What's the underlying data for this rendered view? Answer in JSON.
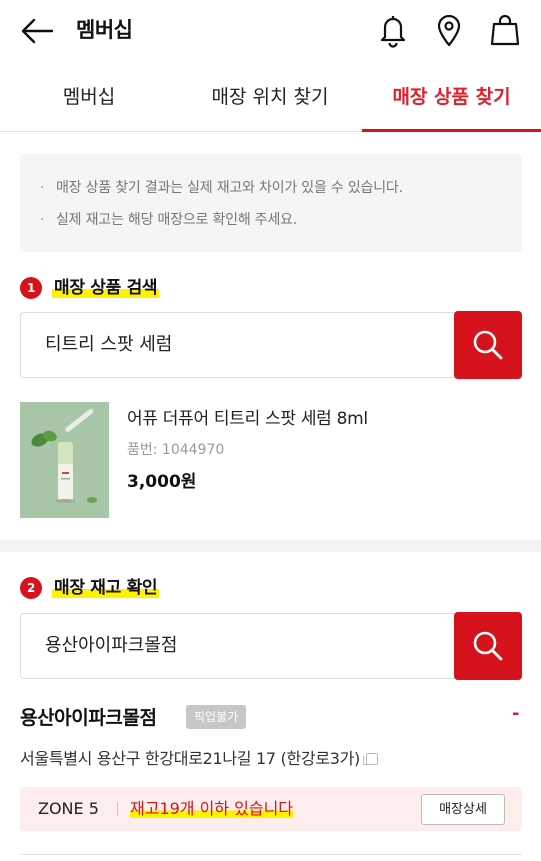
{
  "header": {
    "title": "멤버십"
  },
  "tabs": [
    {
      "label": "멤버십",
      "active": false
    },
    {
      "label": "매장 위치 찾기",
      "active": false
    },
    {
      "label": "매장 상품 찾기",
      "active": true
    }
  ],
  "notice": {
    "lines": [
      "매장 상품 찾기 결과는 실제 재고와 차이가 있을 수 있습니다.",
      "실제 재고는 해당 매장으로 확인해 주세요."
    ]
  },
  "section1": {
    "number": "1",
    "title": "매장 상품 검색",
    "search_value": "티트리 스팟 세럼"
  },
  "product": {
    "name": "어퓨 더퓨어 티트리 스팟 세럼 8ml",
    "code": "품번: 1044970",
    "price": "3,000원"
  },
  "section2": {
    "number": "2",
    "title": "매장 재고 확인",
    "search_value": "용산아이파크몰점"
  },
  "store": {
    "name": "용산아이파크몰점",
    "pickup_badge": "픽업불가",
    "dash": "-",
    "address": "서울특별시 용산구 한강대로21나길 17 (한강로3가)"
  },
  "zone": {
    "label": "ZONE 5",
    "stock": "재고19개 이하 있습니다",
    "detail_button": "매장상세"
  },
  "colors": {
    "accent": "#d6121c",
    "highlight": "#fff200"
  }
}
